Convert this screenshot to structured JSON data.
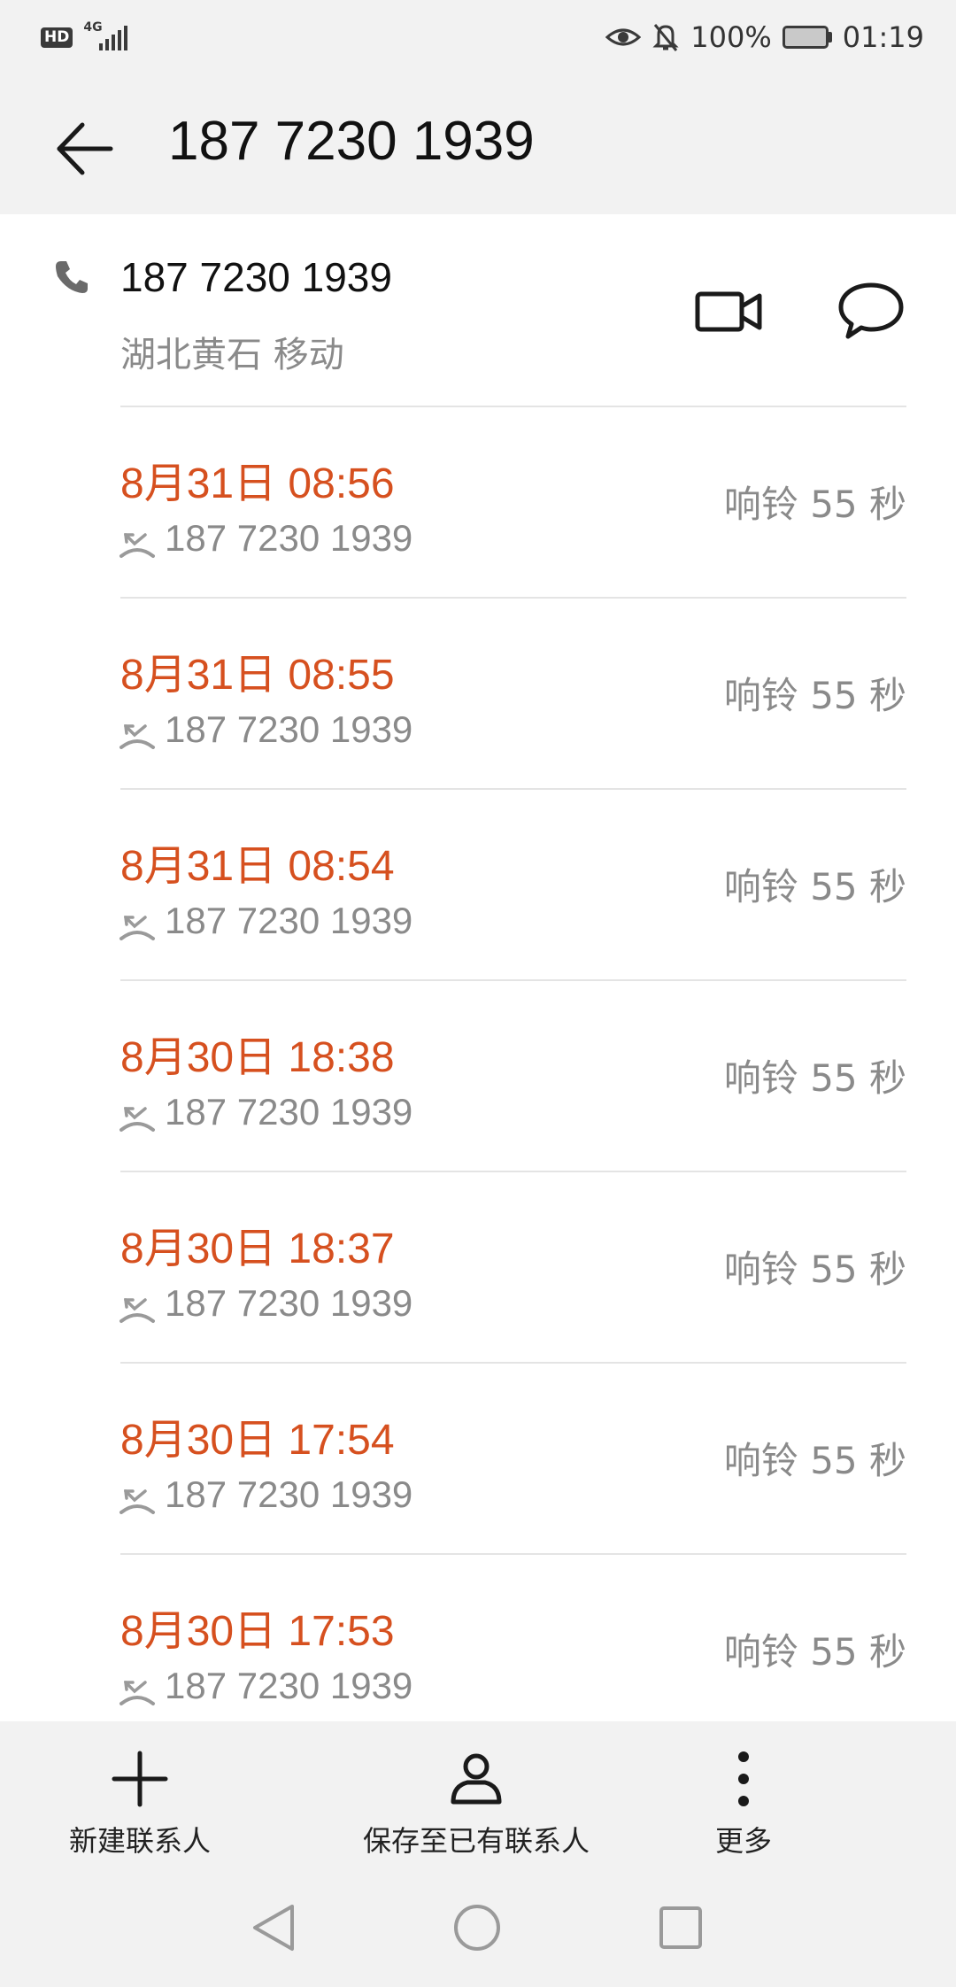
{
  "status_bar": {
    "hd": "HD",
    "network": "4G",
    "battery": "100%",
    "time": "01:19"
  },
  "header": {
    "title": "187 7230 1939"
  },
  "contact": {
    "number": "187 7230 1939",
    "location": "湖北黄石 移动"
  },
  "calls": [
    {
      "time": "8月31日 08:56",
      "number": "187 7230 1939",
      "duration": "响铃 55 秒"
    },
    {
      "time": "8月31日 08:55",
      "number": "187 7230 1939",
      "duration": "响铃 55 秒"
    },
    {
      "time": "8月31日 08:54",
      "number": "187 7230 1939",
      "duration": "响铃 55 秒"
    },
    {
      "time": "8月30日 18:38",
      "number": "187 7230 1939",
      "duration": "响铃 55 秒"
    },
    {
      "time": "8月30日 18:37",
      "number": "187 7230 1939",
      "duration": "响铃 55 秒"
    },
    {
      "time": "8月30日 17:54",
      "number": "187 7230 1939",
      "duration": "响铃 55 秒"
    },
    {
      "time": "8月30日 17:53",
      "number": "187 7230 1939",
      "duration": "响铃 55 秒"
    }
  ],
  "toolbar": {
    "new_contact": "新建联系人",
    "save_existing": "保存至已有联系人",
    "more": "更多"
  },
  "colors": {
    "missed_time": "#d6501f",
    "secondary_text": "#8a8a8a",
    "bar_bg": "#f2f2f2"
  }
}
